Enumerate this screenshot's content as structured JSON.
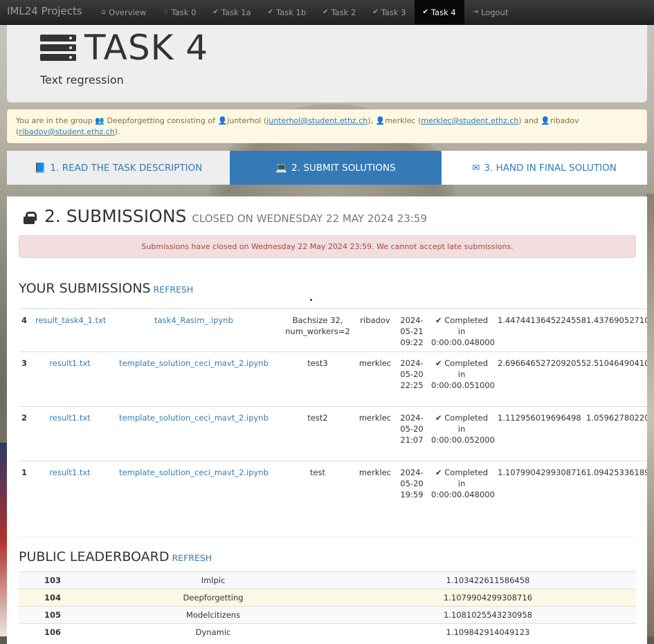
{
  "navbar": {
    "brand": "IML24 Projects",
    "items": [
      {
        "icon": "home-icon",
        "glyph": "⌂",
        "label": "Overview"
      },
      {
        "icon": "spinner-icon",
        "glyph": "⁘",
        "label": "Task 0"
      },
      {
        "icon": "check-icon",
        "glyph": "✔",
        "label": "Task 1a"
      },
      {
        "icon": "check-icon",
        "glyph": "✔",
        "label": "Task 1b"
      },
      {
        "icon": "check-icon",
        "glyph": "✔",
        "label": "Task 2"
      },
      {
        "icon": "check-icon",
        "glyph": "✔",
        "label": "Task 3"
      },
      {
        "icon": "check-icon",
        "glyph": "✔",
        "label": "Task 4"
      },
      {
        "icon": "logout-icon",
        "glyph": "⇥",
        "label": "Logout"
      }
    ],
    "active": "Task 4"
  },
  "header": {
    "title": "TASK 4",
    "subtitle": "Text regression"
  },
  "group": {
    "intro": "You are in the group",
    "group_name": "Deepforgetting",
    "consisting": "consisting of",
    "m1": "junterhol",
    "m1_email": "junterhol@student.ethz.ch",
    "m2": "merklec",
    "m2_email": "merklec@student.ethz.ch",
    "and": "and",
    "m3": "ribadov",
    "m3_email": "ribadov@student.ethz.ch"
  },
  "tabs": [
    "1. READ THE TASK DESCRIPTION",
    "2. SUBMIT SOLUTIONS",
    "3. HAND IN FINAL SOLUTION"
  ],
  "submissions": {
    "title": "2. SUBMISSIONS",
    "closed": "CLOSED ON WEDNESDAY 22 MAY 2024 23:59",
    "alert": "Submissions have closed on Wednesday 22 May 2024 23:59. We cannot accept late submissions."
  },
  "your_subs": {
    "title": "YOUR SUBMISSIONS",
    "refresh": "REFRESH",
    "rows": [
      {
        "num": "4",
        "result": "result_task4_1.txt",
        "notebook": "task4_Rasim_.ipynb",
        "comment": "Bachsize 32, num_workers=2",
        "user": "ribadov",
        "date": "2024-05-21 09:22",
        "status": "Completed in 0:00:00.048000",
        "s1": "1.4474413645224558",
        "s2": "1.43769052710"
      },
      {
        "num": "3",
        "result": "result1.txt",
        "notebook": "template_solution_ceci_mavt_2.ipynb",
        "comment": "test3",
        "user": "merklec",
        "date": "2024-05-20 22:25",
        "status": "Completed in 0:00:00.051000",
        "s1": "2.6966465272092055",
        "s2": "2.51046490410"
      },
      {
        "num": "2",
        "result": "result1.txt",
        "notebook": "template_solution_ceci_mavt_2.ipynb",
        "comment": "test2",
        "user": "merklec",
        "date": "2024-05-20 21:07",
        "status": "Completed in 0:00:00.052000",
        "s1": "1.112956019696498",
        "s2": "1.05962780220"
      },
      {
        "num": "1",
        "result": "result1.txt",
        "notebook": "template_solution_ceci_mavt_2.ipynb",
        "comment": "test",
        "user": "merklec",
        "date": "2024-05-20 19:59",
        "status": "Completed in 0:00:00.048000",
        "s1": "1.1079904299308716",
        "s2": "1.09425336189"
      }
    ]
  },
  "leaderboard": {
    "title": "PUBLIC LEADERBOARD",
    "refresh": "REFRESH",
    "rows": [
      {
        "rank": "103",
        "name": "Imlpic",
        "score": "1.103422611586458"
      },
      {
        "rank": "104",
        "name": "Deepforgetting",
        "score": "1.1079904299308716"
      },
      {
        "rank": "105",
        "name": "Modelcitizens",
        "score": "1.1081025543230958"
      },
      {
        "rank": "106",
        "name": "Dynamic",
        "score": "1.109842914049123"
      }
    ]
  }
}
